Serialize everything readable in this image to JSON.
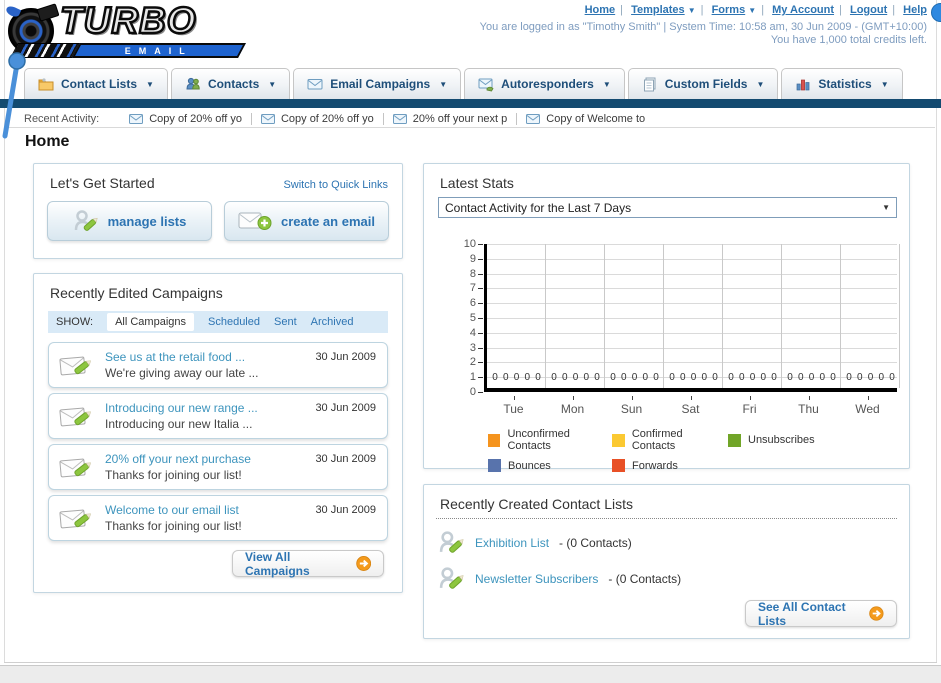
{
  "colors": {
    "accent_link": "#2d74b2",
    "navy_bar": "#134a70",
    "campaign_link": "#3d94bd",
    "button_arrow_orange": "#f49a1c",
    "show_bar_bg": "#d9eaf7"
  },
  "icons": {
    "chevron_down": "▼"
  },
  "header": {
    "logo_main": "TURBO",
    "logo_sub": "EMAIL",
    "nav": [
      {
        "label": "Home"
      },
      {
        "label": "Templates"
      },
      {
        "label": "Forms"
      },
      {
        "label": "My Account"
      },
      {
        "label": "Logout"
      },
      {
        "label": "Help"
      }
    ],
    "login_line": "You are logged in as \"Timothy Smith\" | System Time: 10:58 am, 30 Jun 2009 - (GMT+10:00)",
    "credits_line": "You have 1,000 total credits left."
  },
  "nav_tabs": [
    {
      "label": "Contact Lists"
    },
    {
      "label": "Contacts"
    },
    {
      "label": "Email Campaigns"
    },
    {
      "label": "Autoresponders"
    },
    {
      "label": "Custom Fields"
    },
    {
      "label": "Statistics"
    }
  ],
  "recent_activity": {
    "label": "Recent Activity:",
    "items": [
      "Copy of 20% off yo",
      "Copy of 20% off yo",
      "20% off your next p",
      "Copy of Welcome to"
    ]
  },
  "page_title": "Home",
  "get_started": {
    "title": "Let's Get Started",
    "switch_link": "Switch to Quick Links",
    "manage_lists": "manage lists",
    "create_email": "create an email"
  },
  "campaigns": {
    "title": "Recently Edited Campaigns",
    "show_label": "SHOW:",
    "filters": [
      "All Campaigns",
      "Scheduled",
      "Sent",
      "Archived"
    ],
    "active_filter": "All Campaigns",
    "items": [
      {
        "title": "See us at the retail food ...",
        "subtitle": "We're giving away our late ...",
        "date": "30 Jun 2009"
      },
      {
        "title": "Introducing our new range ...",
        "subtitle": "Introducing our new Italia ...",
        "date": "30 Jun 2009"
      },
      {
        "title": "20% off your next purchase",
        "subtitle": "Thanks for joining our list!",
        "date": "30 Jun 2009"
      },
      {
        "title": "Welcome to our email list",
        "subtitle": "Thanks for joining our list!",
        "date": "30 Jun 2009"
      }
    ],
    "view_all": "View All Campaigns"
  },
  "stats": {
    "title": "Latest Stats",
    "period_selector": "Contact Activity for the Last 7 Days"
  },
  "chart_data": {
    "type": "bar",
    "title": "Contact Activity for the Last 7 Days",
    "categories": [
      "Tue",
      "Mon",
      "Sun",
      "Sat",
      "Fri",
      "Thu",
      "Wed"
    ],
    "series": [
      {
        "name": "Unconfirmed Contacts",
        "color": "#f5941e",
        "values": [
          0,
          0,
          0,
          0,
          0,
          0,
          0
        ]
      },
      {
        "name": "Confirmed Contacts",
        "color": "#fbc932",
        "values": [
          0,
          0,
          0,
          0,
          0,
          0,
          0
        ]
      },
      {
        "name": "Unsubscribes",
        "color": "#71a528",
        "values": [
          0,
          0,
          0,
          0,
          0,
          0,
          0
        ]
      },
      {
        "name": "Bounces",
        "color": "#5873ac",
        "values": [
          0,
          0,
          0,
          0,
          0,
          0,
          0
        ]
      },
      {
        "name": "Forwards",
        "color": "#e85026",
        "values": [
          0,
          0,
          0,
          0,
          0,
          0,
          0
        ]
      }
    ],
    "xlabel": "",
    "ylabel": "",
    "ylim": [
      0,
      10
    ],
    "yticks": [
      0,
      1,
      2,
      3,
      4,
      5,
      6,
      7,
      8,
      9,
      10
    ],
    "grid": true,
    "legend_position": "bottom",
    "value_labels_shown": true
  },
  "contact_lists": {
    "title": "Recently Created Contact Lists",
    "items": [
      {
        "name": "Exhibition List",
        "detail": "- (0 Contacts)"
      },
      {
        "name": "Newsletter Subscribers",
        "detail": "- (0 Contacts)"
      }
    ],
    "see_all": "See All Contact Lists"
  }
}
